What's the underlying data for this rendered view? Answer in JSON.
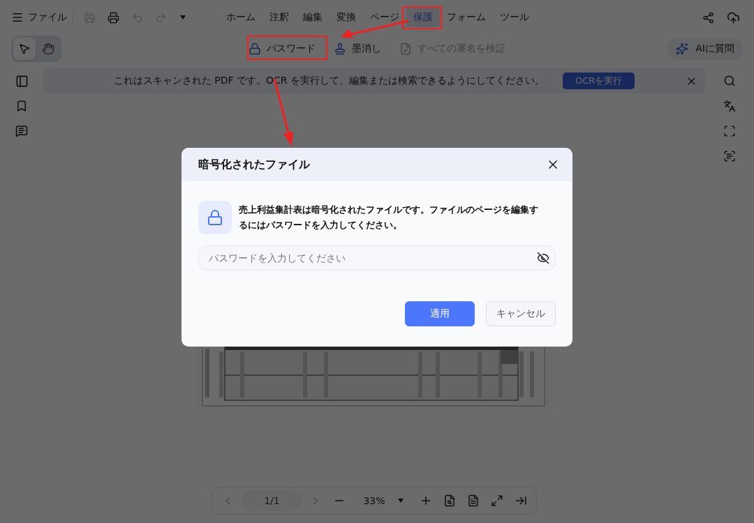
{
  "menu": {
    "label": "ファイル"
  },
  "quick_actions": [
    {
      "kind": "save",
      "disabled": true
    },
    {
      "kind": "print",
      "disabled": false
    },
    {
      "kind": "undo",
      "disabled": true
    },
    {
      "kind": "redo",
      "disabled": true
    }
  ],
  "tabs": [
    {
      "label": "ホーム",
      "selected": false
    },
    {
      "label": "注釈",
      "selected": false
    },
    {
      "label": "編集",
      "selected": false
    },
    {
      "label": "変換",
      "selected": false
    },
    {
      "label": "ページ",
      "selected": false
    },
    {
      "label": "保護",
      "selected": true
    },
    {
      "label": "フォーム",
      "selected": false
    },
    {
      "label": "ツール",
      "selected": false
    }
  ],
  "tools": [
    {
      "kind": "select",
      "selected": true
    },
    {
      "kind": "hand",
      "selected": false
    }
  ],
  "actions": [
    {
      "kind": "lock",
      "label": "パスワード",
      "disabled": false
    },
    {
      "kind": "redact",
      "label": "墨消し",
      "disabled": false
    },
    {
      "kind": "verify",
      "label": "すべての署名を検証",
      "disabled": true
    }
  ],
  "ai_button": {
    "label": "AIに質問"
  },
  "banner": {
    "message": "これはスキャンされた PDF です。OCR を実行して、編集または検索できるようにしてください。",
    "action": "OCRを実行"
  },
  "page_nav": {
    "page": "1/1",
    "zoom": "33%"
  },
  "dialog": {
    "title": "暗号化されたファイル",
    "message": "売上利益集計表は暗号化されたファイルです。ファイルのページを編集するにはパスワードを入力してください。",
    "password": {
      "placeholder": "パスワードを入力してください"
    },
    "buttons": [
      {
        "kind": "primary",
        "label": "適用"
      },
      {
        "kind": "secondary",
        "label": "キャンセル"
      }
    ]
  }
}
